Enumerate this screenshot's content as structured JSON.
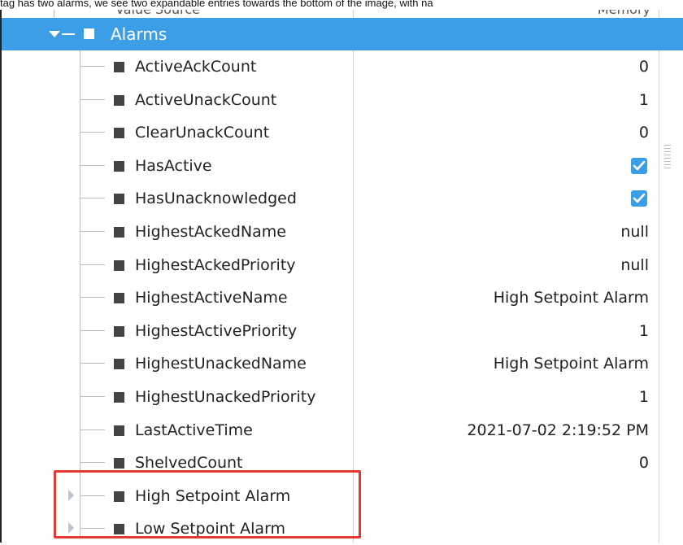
{
  "caption": "tag has two alarms, we see two expandable entries towards the bottom of the image, with na",
  "header": {
    "left_label": "Value Source",
    "right_label": "Memory"
  },
  "tree": {
    "root": {
      "label": "Alarms"
    },
    "properties": [
      {
        "name": "ActiveAckCount",
        "value": "0"
      },
      {
        "name": "ActiveUnackCount",
        "value": "1"
      },
      {
        "name": "ClearUnackCount",
        "value": "0"
      },
      {
        "name": "HasActive",
        "checked": true
      },
      {
        "name": "HasUnacknowledged",
        "checked": true
      },
      {
        "name": "HighestAckedName",
        "value": "null"
      },
      {
        "name": "HighestAckedPriority",
        "value": "null"
      },
      {
        "name": "HighestActiveName",
        "value": "High Setpoint Alarm"
      },
      {
        "name": "HighestActivePriority",
        "value": "1"
      },
      {
        "name": "HighestUnackedName",
        "value": "High Setpoint Alarm"
      },
      {
        "name": "HighestUnackedPriority",
        "value": "1"
      },
      {
        "name": "LastActiveTime",
        "value": "2021-07-02 2:19:52 PM"
      },
      {
        "name": "ShelvedCount",
        "value": "0"
      }
    ],
    "alarms": [
      {
        "name": "High Setpoint Alarm"
      },
      {
        "name": "Low Setpoint Alarm"
      }
    ]
  },
  "colors": {
    "selection": "#3d9ee8",
    "highlight_box": "#e53935",
    "checkbox": "#3d9ee8"
  }
}
